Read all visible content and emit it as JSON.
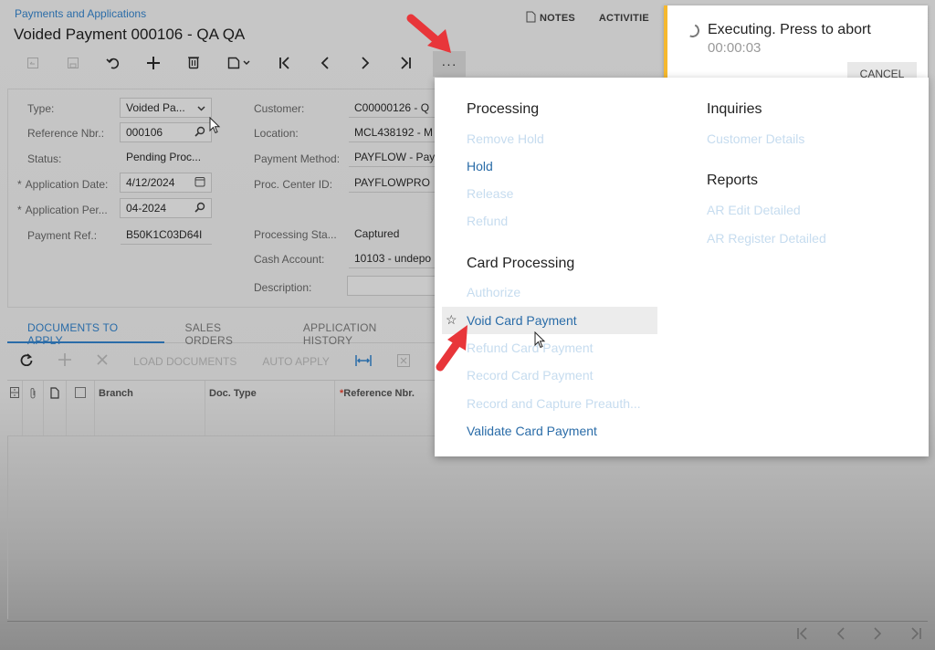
{
  "header": {
    "breadcrumb": "Payments and Applications",
    "title": "Voided Payment 000106 - QA QA",
    "links": [
      {
        "label": "NOTES",
        "icon": "note-icon"
      },
      {
        "label": "ACTIVITIE",
        "icon": null
      }
    ]
  },
  "toolbar": {
    "buttons": [
      {
        "name": "save-close",
        "icon": "save-close-icon",
        "glyph": "⎘",
        "disabled": true
      },
      {
        "name": "save",
        "icon": "save-icon",
        "glyph": "🖫",
        "disabled": true
      },
      {
        "name": "undo",
        "icon": "undo-icon",
        "glyph": "↶",
        "disabled": false
      },
      {
        "name": "add",
        "icon": "plus-icon",
        "glyph": "+",
        "disabled": false
      },
      {
        "name": "delete",
        "icon": "trash-icon",
        "glyph": "🗑",
        "disabled": false
      },
      {
        "name": "copy-paste",
        "icon": "copy-icon",
        "glyph": "❐ ˅",
        "disabled": false
      },
      {
        "name": "first",
        "icon": "first-icon",
        "glyph": "|<",
        "disabled": false
      },
      {
        "name": "prev",
        "icon": "prev-icon",
        "glyph": "<",
        "disabled": false
      },
      {
        "name": "next",
        "icon": "next-icon",
        "glyph": ">",
        "disabled": false
      },
      {
        "name": "last",
        "icon": "last-icon",
        "glyph": ">|",
        "disabled": false
      }
    ],
    "more_glyph": "···"
  },
  "form": {
    "type": {
      "label": "Type:",
      "value": "Voided Pa..."
    },
    "reference_nbr": {
      "label": "Reference Nbr.:",
      "value": "000106"
    },
    "status": {
      "label": "Status:",
      "value": "Pending Proc..."
    },
    "application_date": {
      "label": "Application Date:",
      "value": "4/12/2024",
      "required": true
    },
    "application_period": {
      "label": "Application Per...",
      "value": "04-2024",
      "required": true
    },
    "payment_ref": {
      "label": "Payment Ref.:",
      "value": "B50K1C03D64I"
    },
    "customer": {
      "label": "Customer:",
      "value": "C00000126 - Q"
    },
    "location": {
      "label": "Location:",
      "value": "MCL438192 - M"
    },
    "payment_method": {
      "label": "Payment Method:",
      "value": "PAYFLOW - Pay"
    },
    "proc_center_id": {
      "label": "Proc. Center ID:",
      "value": "PAYFLOWPRO"
    },
    "processing_status": {
      "label": "Processing Sta...",
      "value": "Captured"
    },
    "cash_account": {
      "label": "Cash Account:",
      "value": "10103 - undepo"
    },
    "description": {
      "label": "Description:",
      "value": ""
    }
  },
  "tabs": [
    {
      "label": "DOCUMENTS TO APPLY",
      "active": true
    },
    {
      "label": "SALES ORDERS",
      "active": false
    },
    {
      "label": "APPLICATION HISTORY",
      "active": false
    }
  ],
  "grid_toolbar": {
    "load_documents": "LOAD DOCUMENTS",
    "auto_apply": "AUTO APPLY"
  },
  "grid": {
    "columns": [
      "Branch",
      "Doc. Type",
      "Reference Nbr."
    ]
  },
  "toast": {
    "message": "Executing. Press to abort",
    "timer": "00:00:03",
    "cancel_label": "CANCEL",
    "accent": "#f5b82e"
  },
  "menu": {
    "processing": {
      "heading": "Processing",
      "items": [
        {
          "label": "Remove Hold",
          "enabled": false
        },
        {
          "label": "Hold",
          "enabled": true
        },
        {
          "label": "Release",
          "enabled": false
        },
        {
          "label": "Refund",
          "enabled": false
        }
      ]
    },
    "card_processing": {
      "heading": "Card Processing",
      "items": [
        {
          "label": "Authorize",
          "enabled": false
        },
        {
          "label": "Void Card Payment",
          "enabled": true,
          "hovered": true
        },
        {
          "label": "Refund Card Payment",
          "enabled": false
        },
        {
          "label": "Record Card Payment",
          "enabled": false
        },
        {
          "label": "Record and Capture Preauth...",
          "enabled": false
        },
        {
          "label": "Validate Card Payment",
          "enabled": true
        }
      ]
    },
    "inquiries": {
      "heading": "Inquiries",
      "items": [
        {
          "label": "Customer Details",
          "enabled": false
        }
      ]
    },
    "reports": {
      "heading": "Reports",
      "items": [
        {
          "label": "AR Edit Detailed",
          "enabled": false
        },
        {
          "label": "AR Register Detailed",
          "enabled": false
        }
      ]
    }
  },
  "colors": {
    "link_blue": "#2a6ca8",
    "disabled_blue": "#c6dcef",
    "annotation_red": "#e8363a"
  }
}
